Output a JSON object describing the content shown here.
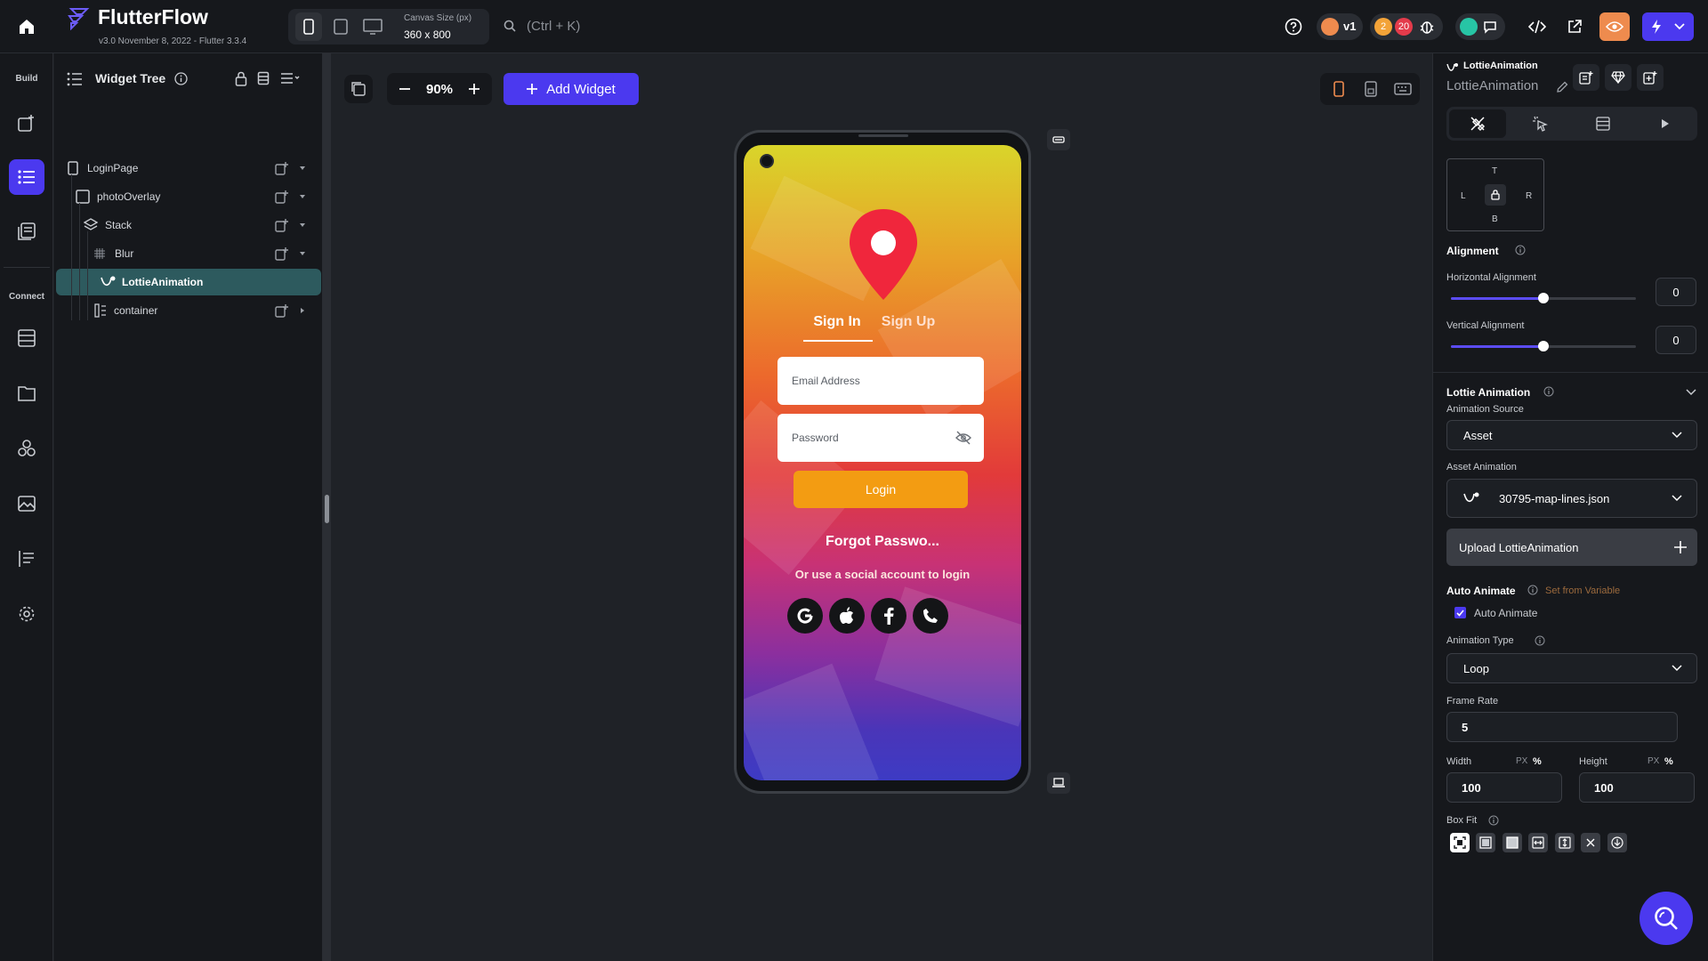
{
  "topbar": {
    "app_name": "FlutterFlow",
    "version": "v3.0 November 8, 2022 - Flutter 3.3.4",
    "canvas_size_label": "Canvas Size (px)",
    "canvas_size_value": "360 x 800",
    "search_hint": "(Ctrl + K)",
    "version_badge": "v1",
    "warnings_count": "2",
    "errors_count": "20"
  },
  "rail": {
    "build_label": "Build",
    "connect_label": "Connect"
  },
  "tree": {
    "title": "Widget Tree",
    "items": [
      {
        "label": "LoginPage"
      },
      {
        "label": "photoOverlay"
      },
      {
        "label": "Stack"
      },
      {
        "label": "Blur"
      },
      {
        "label": "LottieAnimation"
      },
      {
        "label": "container"
      }
    ]
  },
  "canvas_toolbar": {
    "zoom": "90%",
    "add_widget": "Add Widget"
  },
  "phone": {
    "tab_signin": "Sign In",
    "tab_signup": "Sign Up",
    "email_placeholder": "Email Address",
    "password_placeholder": "Password",
    "login_label": "Login",
    "forgot_label": "Forgot Passwo...",
    "social_label": "Or use a social account to login",
    "accent": "#f39c12",
    "social_icons": [
      "google-icon",
      "apple-icon",
      "facebook-icon",
      "phone-icon"
    ]
  },
  "props": {
    "widget_type": "LottieAnimation",
    "widget_name": "LottieAnimation",
    "padding_labels": {
      "t": "T",
      "l": "L",
      "r": "R",
      "b": "B"
    },
    "alignment_title": "Alignment",
    "horizontal_label": "Horizontal Alignment",
    "horizontal_value": "0",
    "horizontal_fraction": 0.5,
    "vertical_label": "Vertical Alignment",
    "vertical_value": "0",
    "vertical_fraction": 0.5,
    "lottie_title": "Lottie Animation",
    "source_label": "Animation Source",
    "source_value": "Asset",
    "asset_label": "Asset Animation",
    "asset_value": "30795-map-lines.json",
    "upload_label": "Upload LottieAnimation",
    "auto_animate_title": "Auto Animate",
    "set_from_variable": "Set from Variable",
    "auto_animate_checkbox": "Auto Animate",
    "auto_animate_checked": true,
    "type_label": "Animation Type",
    "type_value": "Loop",
    "frame_rate_label": "Frame Rate",
    "frame_rate_value": "5",
    "width_label": "Width",
    "width_value": "100",
    "height_label": "Height",
    "height_value": "100",
    "unit_px": "PX",
    "unit_pct": "%",
    "box_fit_label": "Box Fit"
  },
  "colors": {
    "brand": "#4b39ef",
    "selected_row": "#2d5a5e",
    "orange": "#ee8b4e"
  }
}
